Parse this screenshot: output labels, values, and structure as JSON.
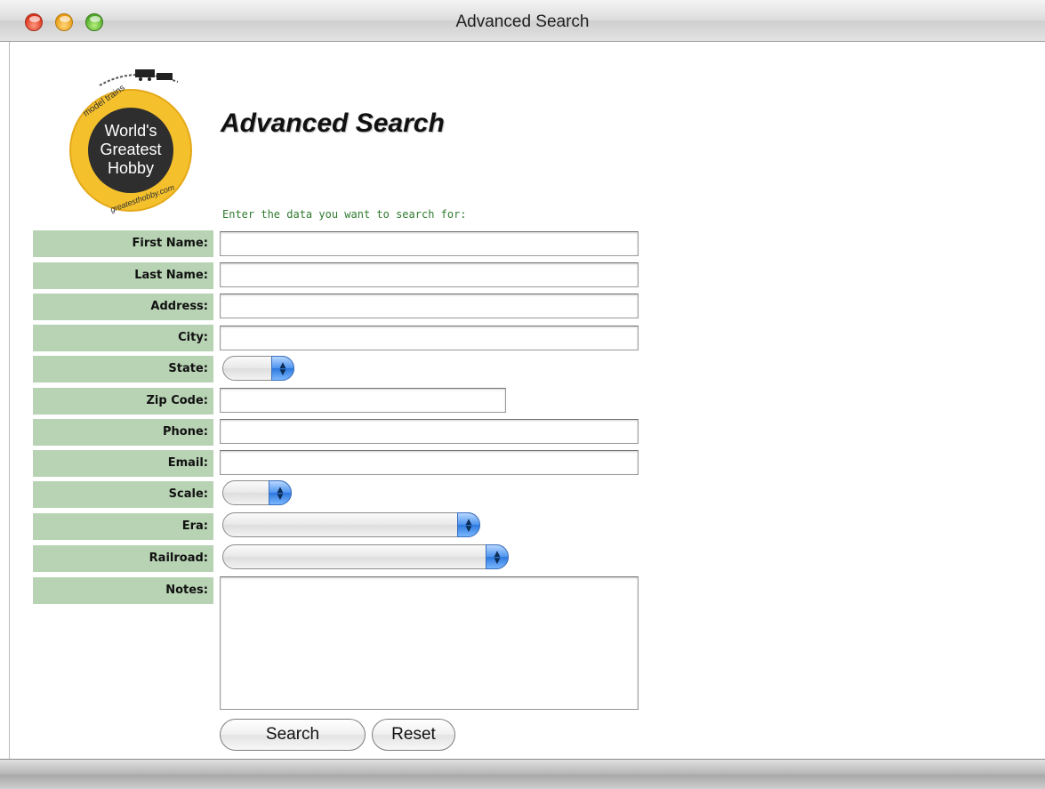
{
  "window": {
    "title": "Advanced Search"
  },
  "logo": {
    "center_text_lines": [
      "World's",
      "Greatest",
      "Hobby"
    ],
    "ring_top_text": "model trains",
    "ring_bottom_text": "greatesthobby.com",
    "accent_color": "#f4c02c"
  },
  "page": {
    "title": "Advanced Search",
    "instruction": "Enter the data you want to search for:"
  },
  "form": {
    "fields": [
      {
        "label": "First Name:",
        "type": "text",
        "value": ""
      },
      {
        "label": "Last Name:",
        "type": "text",
        "value": ""
      },
      {
        "label": "Address:",
        "type": "text",
        "value": ""
      },
      {
        "label": "City:",
        "type": "text",
        "value": ""
      },
      {
        "label": "State:",
        "type": "select",
        "value": ""
      },
      {
        "label": "Zip Code:",
        "type": "text",
        "value": ""
      },
      {
        "label": "Phone:",
        "type": "text",
        "value": ""
      },
      {
        "label": "Email:",
        "type": "text",
        "value": ""
      },
      {
        "label": "Scale:",
        "type": "select",
        "value": ""
      },
      {
        "label": "Era:",
        "type": "select",
        "value": ""
      },
      {
        "label": "Railroad:",
        "type": "select",
        "value": ""
      },
      {
        "label": "Notes:",
        "type": "textarea",
        "value": ""
      }
    ],
    "label_color": "#b8d3b4",
    "instruction_color": "#2f7a2f"
  },
  "buttons": {
    "search": "Search",
    "reset": "Reset"
  }
}
